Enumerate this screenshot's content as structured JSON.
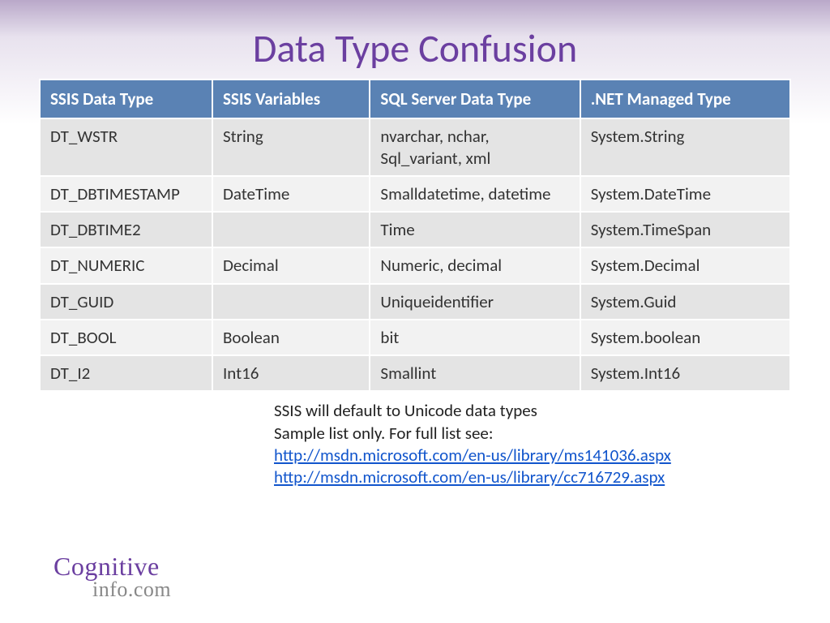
{
  "title": "Data Type Confusion",
  "table": {
    "headers": [
      "SSIS Data Type",
      "SSIS Variables",
      "SQL Server Data Type",
      ".NET Managed Type"
    ],
    "rows": [
      [
        "DT_WSTR",
        "String",
        "nvarchar, nchar, Sql_variant, xml",
        "System.String"
      ],
      [
        "DT_DBTIMESTAMP",
        "DateTime",
        "Smalldatetime, datetime",
        "System.DateTime"
      ],
      [
        "DT_DBTIME2",
        "",
        "Time",
        "System.TimeSpan"
      ],
      [
        "DT_NUMERIC",
        "Decimal",
        "Numeric, decimal",
        "System.Decimal"
      ],
      [
        "DT_GUID",
        "",
        "Uniqueidentifier",
        "System.Guid"
      ],
      [
        "DT_BOOL",
        "Boolean",
        "bit",
        "System.boolean"
      ],
      [
        "DT_I2",
        "Int16",
        "Smallint",
        "System.Int16"
      ]
    ]
  },
  "notes": {
    "line1": "SSIS will default to Unicode data types",
    "line2": "Sample list only.  For full list see:",
    "link1": "http://msdn.microsoft.com/en-us/library/ms141036.aspx",
    "link2": "http://msdn.microsoft.com/en-us/library/cc716729.aspx"
  },
  "logo": {
    "line1": "Cognitive",
    "line2": "info.com"
  }
}
